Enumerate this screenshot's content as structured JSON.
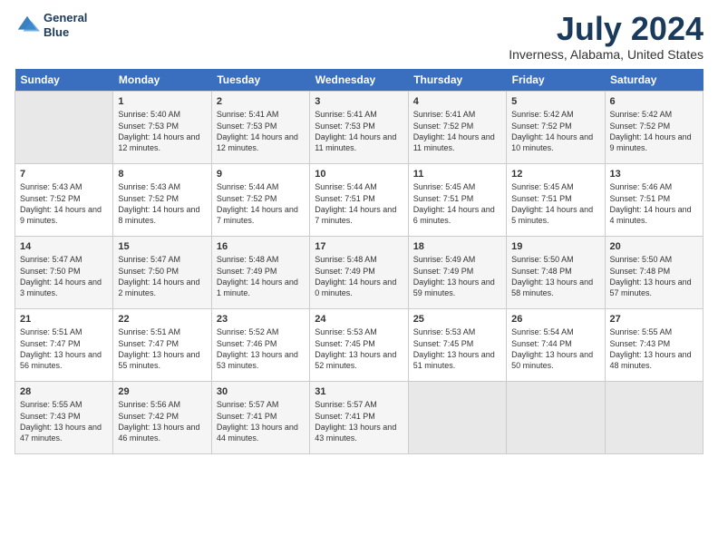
{
  "header": {
    "logo_line1": "General",
    "logo_line2": "Blue",
    "title": "July 2024",
    "subtitle": "Inverness, Alabama, United States"
  },
  "days_of_week": [
    "Sunday",
    "Monday",
    "Tuesday",
    "Wednesday",
    "Thursday",
    "Friday",
    "Saturday"
  ],
  "weeks": [
    [
      {
        "day": "",
        "empty": true
      },
      {
        "day": "1",
        "sunrise": "Sunrise: 5:40 AM",
        "sunset": "Sunset: 7:53 PM",
        "daylight": "Daylight: 14 hours and 12 minutes."
      },
      {
        "day": "2",
        "sunrise": "Sunrise: 5:41 AM",
        "sunset": "Sunset: 7:53 PM",
        "daylight": "Daylight: 14 hours and 12 minutes."
      },
      {
        "day": "3",
        "sunrise": "Sunrise: 5:41 AM",
        "sunset": "Sunset: 7:53 PM",
        "daylight": "Daylight: 14 hours and 11 minutes."
      },
      {
        "day": "4",
        "sunrise": "Sunrise: 5:41 AM",
        "sunset": "Sunset: 7:52 PM",
        "daylight": "Daylight: 14 hours and 11 minutes."
      },
      {
        "day": "5",
        "sunrise": "Sunrise: 5:42 AM",
        "sunset": "Sunset: 7:52 PM",
        "daylight": "Daylight: 14 hours and 10 minutes."
      },
      {
        "day": "6",
        "sunrise": "Sunrise: 5:42 AM",
        "sunset": "Sunset: 7:52 PM",
        "daylight": "Daylight: 14 hours and 9 minutes."
      }
    ],
    [
      {
        "day": "7",
        "sunrise": "Sunrise: 5:43 AM",
        "sunset": "Sunset: 7:52 PM",
        "daylight": "Daylight: 14 hours and 9 minutes."
      },
      {
        "day": "8",
        "sunrise": "Sunrise: 5:43 AM",
        "sunset": "Sunset: 7:52 PM",
        "daylight": "Daylight: 14 hours and 8 minutes."
      },
      {
        "day": "9",
        "sunrise": "Sunrise: 5:44 AM",
        "sunset": "Sunset: 7:52 PM",
        "daylight": "Daylight: 14 hours and 7 minutes."
      },
      {
        "day": "10",
        "sunrise": "Sunrise: 5:44 AM",
        "sunset": "Sunset: 7:51 PM",
        "daylight": "Daylight: 14 hours and 7 minutes."
      },
      {
        "day": "11",
        "sunrise": "Sunrise: 5:45 AM",
        "sunset": "Sunset: 7:51 PM",
        "daylight": "Daylight: 14 hours and 6 minutes."
      },
      {
        "day": "12",
        "sunrise": "Sunrise: 5:45 AM",
        "sunset": "Sunset: 7:51 PM",
        "daylight": "Daylight: 14 hours and 5 minutes."
      },
      {
        "day": "13",
        "sunrise": "Sunrise: 5:46 AM",
        "sunset": "Sunset: 7:51 PM",
        "daylight": "Daylight: 14 hours and 4 minutes."
      }
    ],
    [
      {
        "day": "14",
        "sunrise": "Sunrise: 5:47 AM",
        "sunset": "Sunset: 7:50 PM",
        "daylight": "Daylight: 14 hours and 3 minutes."
      },
      {
        "day": "15",
        "sunrise": "Sunrise: 5:47 AM",
        "sunset": "Sunset: 7:50 PM",
        "daylight": "Daylight: 14 hours and 2 minutes."
      },
      {
        "day": "16",
        "sunrise": "Sunrise: 5:48 AM",
        "sunset": "Sunset: 7:49 PM",
        "daylight": "Daylight: 14 hours and 1 minute."
      },
      {
        "day": "17",
        "sunrise": "Sunrise: 5:48 AM",
        "sunset": "Sunset: 7:49 PM",
        "daylight": "Daylight: 14 hours and 0 minutes."
      },
      {
        "day": "18",
        "sunrise": "Sunrise: 5:49 AM",
        "sunset": "Sunset: 7:49 PM",
        "daylight": "Daylight: 13 hours and 59 minutes."
      },
      {
        "day": "19",
        "sunrise": "Sunrise: 5:50 AM",
        "sunset": "Sunset: 7:48 PM",
        "daylight": "Daylight: 13 hours and 58 minutes."
      },
      {
        "day": "20",
        "sunrise": "Sunrise: 5:50 AM",
        "sunset": "Sunset: 7:48 PM",
        "daylight": "Daylight: 13 hours and 57 minutes."
      }
    ],
    [
      {
        "day": "21",
        "sunrise": "Sunrise: 5:51 AM",
        "sunset": "Sunset: 7:47 PM",
        "daylight": "Daylight: 13 hours and 56 minutes."
      },
      {
        "day": "22",
        "sunrise": "Sunrise: 5:51 AM",
        "sunset": "Sunset: 7:47 PM",
        "daylight": "Daylight: 13 hours and 55 minutes."
      },
      {
        "day": "23",
        "sunrise": "Sunrise: 5:52 AM",
        "sunset": "Sunset: 7:46 PM",
        "daylight": "Daylight: 13 hours and 53 minutes."
      },
      {
        "day": "24",
        "sunrise": "Sunrise: 5:53 AM",
        "sunset": "Sunset: 7:45 PM",
        "daylight": "Daylight: 13 hours and 52 minutes."
      },
      {
        "day": "25",
        "sunrise": "Sunrise: 5:53 AM",
        "sunset": "Sunset: 7:45 PM",
        "daylight": "Daylight: 13 hours and 51 minutes."
      },
      {
        "day": "26",
        "sunrise": "Sunrise: 5:54 AM",
        "sunset": "Sunset: 7:44 PM",
        "daylight": "Daylight: 13 hours and 50 minutes."
      },
      {
        "day": "27",
        "sunrise": "Sunrise: 5:55 AM",
        "sunset": "Sunset: 7:43 PM",
        "daylight": "Daylight: 13 hours and 48 minutes."
      }
    ],
    [
      {
        "day": "28",
        "sunrise": "Sunrise: 5:55 AM",
        "sunset": "Sunset: 7:43 PM",
        "daylight": "Daylight: 13 hours and 47 minutes."
      },
      {
        "day": "29",
        "sunrise": "Sunrise: 5:56 AM",
        "sunset": "Sunset: 7:42 PM",
        "daylight": "Daylight: 13 hours and 46 minutes."
      },
      {
        "day": "30",
        "sunrise": "Sunrise: 5:57 AM",
        "sunset": "Sunset: 7:41 PM",
        "daylight": "Daylight: 13 hours and 44 minutes."
      },
      {
        "day": "31",
        "sunrise": "Sunrise: 5:57 AM",
        "sunset": "Sunset: 7:41 PM",
        "daylight": "Daylight: 13 hours and 43 minutes."
      },
      {
        "day": "",
        "empty": true
      },
      {
        "day": "",
        "empty": true
      },
      {
        "day": "",
        "empty": true
      }
    ]
  ]
}
